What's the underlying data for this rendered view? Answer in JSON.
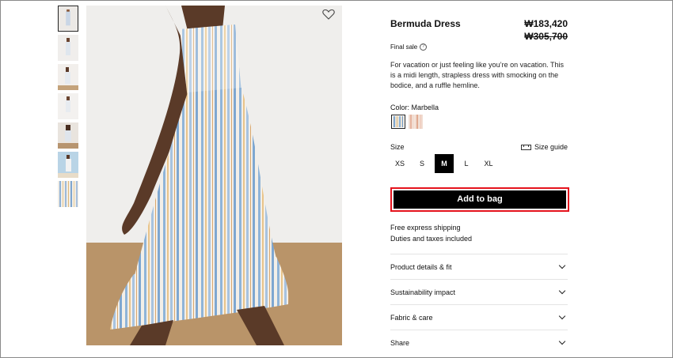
{
  "product": {
    "title": "Bermuda Dress",
    "price": "₩183,420",
    "original_price": "₩305,700",
    "final_sale": "Final sale",
    "description": "For vacation or just feeling like you’re on vacation. This is a midi length, strapless dress with smocking on the bodice, and a ruffle hemline."
  },
  "color": {
    "label": "Color: Marbella",
    "swatches": [
      "blue-stripe",
      "peach-stripe"
    ],
    "selected": "blue-stripe"
  },
  "size": {
    "label": "Size",
    "guide_label": "Size guide",
    "options": [
      "XS",
      "S",
      "M",
      "L",
      "XL"
    ],
    "selected": "M"
  },
  "cta": {
    "add_to_bag": "Add to bag"
  },
  "shipping": {
    "line1": "Free express shipping",
    "line2": "Duties and taxes included"
  },
  "accordions": [
    "Product details & fit",
    "Sustainability impact",
    "Fabric & care",
    "Share"
  ],
  "gallery": {
    "thumbnail_count": 7,
    "active_index": 0
  },
  "colors": {
    "accent_border": "#e5131d",
    "button_bg": "#000000"
  }
}
